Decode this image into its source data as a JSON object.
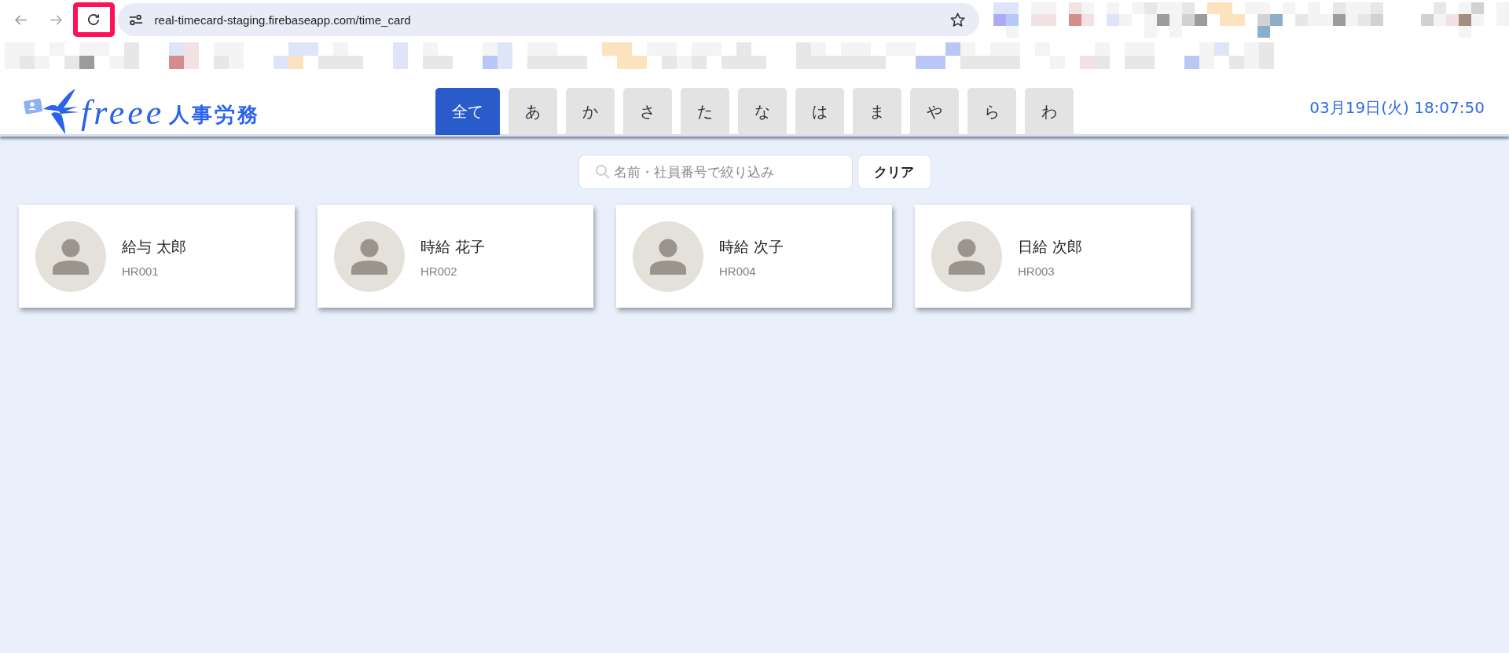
{
  "browser": {
    "url": "real-timecard-staging.firebaseapp.com/time_card",
    "reload_highlighted": true
  },
  "header": {
    "logo": {
      "wordmark": "freee",
      "product": "人事労務"
    },
    "tabs": [
      {
        "label": "全て",
        "selected": true
      },
      {
        "label": "あ",
        "selected": false
      },
      {
        "label": "か",
        "selected": false
      },
      {
        "label": "さ",
        "selected": false
      },
      {
        "label": "た",
        "selected": false
      },
      {
        "label": "な",
        "selected": false
      },
      {
        "label": "は",
        "selected": false
      },
      {
        "label": "ま",
        "selected": false
      },
      {
        "label": "や",
        "selected": false
      },
      {
        "label": "ら",
        "selected": false
      },
      {
        "label": "わ",
        "selected": false
      }
    ],
    "datetime": "03月19日(火) 18:07:50"
  },
  "search": {
    "placeholder": "名前・社員番号で絞り込み",
    "clear_button": "クリア"
  },
  "employees": [
    {
      "name": "給与 太郎",
      "code": "HR001"
    },
    {
      "name": "時給 花子",
      "code": "HR002"
    },
    {
      "name": "時給 次子",
      "code": "HR004"
    },
    {
      "name": "日給 次郎",
      "code": "HR003"
    }
  ]
}
